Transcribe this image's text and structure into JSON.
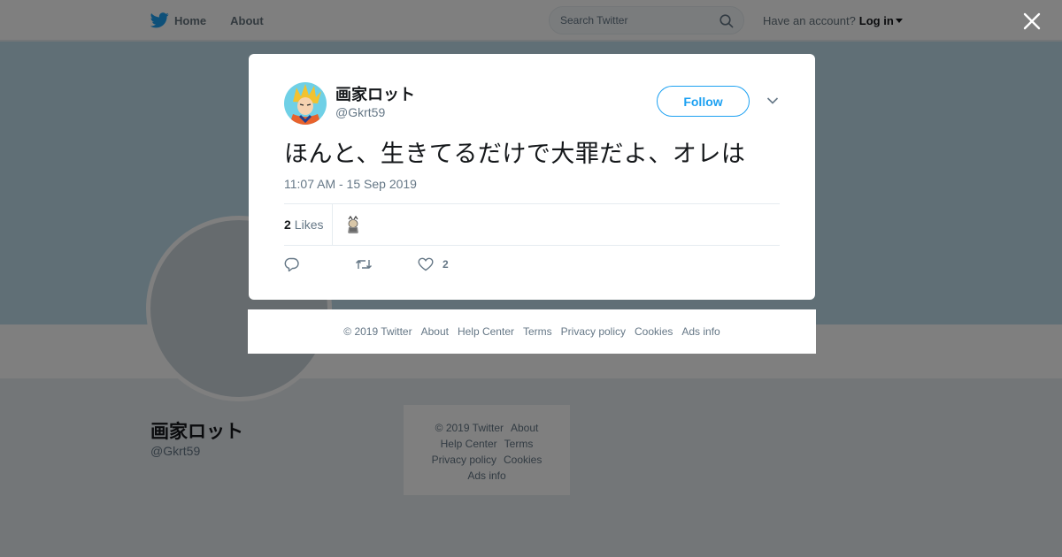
{
  "nav": {
    "home_label": "Home",
    "about_label": "About",
    "search_placeholder": "Search Twitter",
    "account_prompt": "Have an account?",
    "login_label": "Log in"
  },
  "profile": {
    "name": "画家ロット",
    "handle": "@Gkrt59"
  },
  "bg_footer": {
    "copyright": "© 2019 Twitter",
    "about": "About",
    "help": "Help Center",
    "terms": "Terms",
    "privacy": "Privacy policy",
    "cookies": "Cookies",
    "ads": "Ads info"
  },
  "tweet": {
    "author_name": "画家ロット",
    "author_handle": "@Gkrt59",
    "follow_label": "Follow",
    "text": "ほんと、生きてるだけで大罪だよ、オレは",
    "timestamp": "11:07 AM - 15 Sep 2019",
    "likes_count": "2",
    "likes_label": "Likes",
    "action_like_count": "2"
  },
  "modal_footer": {
    "copyright": "© 2019 Twitter",
    "about": "About",
    "help": "Help Center",
    "terms": "Terms",
    "privacy": "Privacy policy",
    "cookies": "Cookies",
    "ads": "Ads info"
  },
  "colors": {
    "brand": "#1da1f2",
    "overlay": "rgba(0,0,0,0.5)",
    "banner": "#c0deed"
  },
  "icons": [
    "twitter-bird-icon",
    "home-icon",
    "search-icon",
    "close-icon",
    "chevron-down-icon",
    "reply-icon",
    "retweet-icon",
    "heart-icon"
  ]
}
